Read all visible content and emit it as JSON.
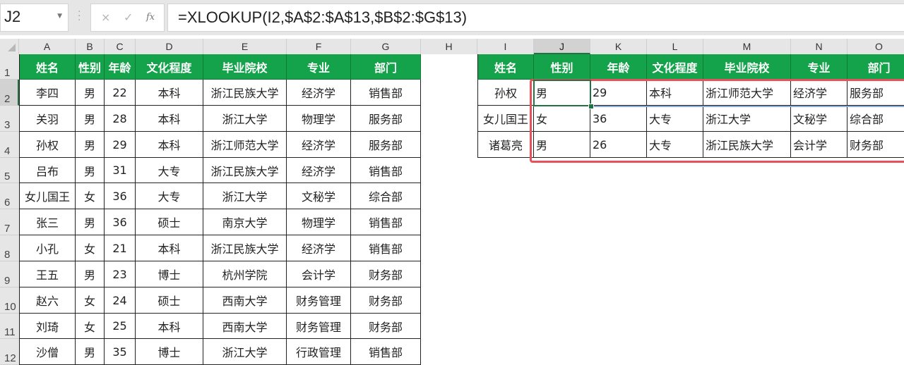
{
  "formula_bar": {
    "name_box": "J2",
    "cancel_icon": "×",
    "enter_icon": "✓",
    "fx_label": "fx",
    "formula": "=XLOOKUP(I2,$A$2:$A$13,$B$2:$G$13)"
  },
  "columns": [
    "A",
    "B",
    "C",
    "D",
    "E",
    "F",
    "G",
    "H",
    "I",
    "J",
    "K",
    "L",
    "M",
    "N",
    "O"
  ],
  "rows": [
    "1",
    "2",
    "3",
    "4",
    "5",
    "6",
    "7",
    "8",
    "9",
    "10",
    "11",
    "12"
  ],
  "selected_cell": "J2",
  "source_table": {
    "headers": [
      "姓名",
      "性别",
      "年龄",
      "文化程度",
      "毕业院校",
      "专业",
      "部门"
    ],
    "rows": [
      [
        "李四",
        "男",
        "22",
        "本科",
        "浙江民族大学",
        "经济学",
        "销售部"
      ],
      [
        "关羽",
        "男",
        "28",
        "本科",
        "浙江大学",
        "物理学",
        "服务部"
      ],
      [
        "孙权",
        "男",
        "29",
        "本科",
        "浙江师范大学",
        "经济学",
        "服务部"
      ],
      [
        "吕布",
        "男",
        "31",
        "大专",
        "浙江民族大学",
        "经济学",
        "销售部"
      ],
      [
        "女儿国王",
        "女",
        "36",
        "大专",
        "浙江大学",
        "文秘学",
        "综合部"
      ],
      [
        "张三",
        "男",
        "36",
        "硕士",
        "南京大学",
        "物理学",
        "销售部"
      ],
      [
        "小孔",
        "女",
        "21",
        "本科",
        "浙江民族大学",
        "经济学",
        "销售部"
      ],
      [
        "王五",
        "男",
        "23",
        "博士",
        "杭州学院",
        "会计学",
        "财务部"
      ],
      [
        "赵六",
        "女",
        "24",
        "硕士",
        "西南大学",
        "财务管理",
        "财务部"
      ],
      [
        "刘琦",
        "女",
        "25",
        "本科",
        "西南大学",
        "财务管理",
        "财务部"
      ],
      [
        "沙僧",
        "男",
        "35",
        "博士",
        "浙江大学",
        "行政管理",
        "销售部"
      ]
    ]
  },
  "lookup_table": {
    "headers": [
      "姓名",
      "性别",
      "年龄",
      "文化程度",
      "毕业院校",
      "专业",
      "部门"
    ],
    "rows": [
      [
        "孙权",
        "男",
        "29",
        "本科",
        "浙江师范大学",
        "经济学",
        "服务部"
      ],
      [
        "女儿国王",
        "女",
        "36",
        "大专",
        "浙江大学",
        "文秘学",
        "综合部"
      ],
      [
        "诸葛亮",
        "男",
        "26",
        "大专",
        "浙江民族大学",
        "会计学",
        "财务部"
      ]
    ]
  },
  "colors": {
    "header_green": "#14a34a",
    "highlight_red": "#e8505b",
    "selection_green": "#217346"
  }
}
